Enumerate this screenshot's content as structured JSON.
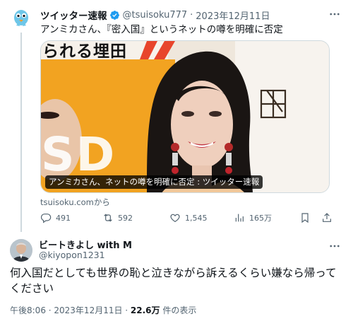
{
  "parent_tweet": {
    "display_name": "ツイッター速報",
    "handle": "@tsuisoku777",
    "separator": "·",
    "date": "2023年12月11日",
    "text": "アンミカさん、『密入国』というネットの噂を明確に否定",
    "card": {
      "banner_text": "られる埋田",
      "watermark_text": "SD",
      "caption": "アンミカさん、ネットの噂を明確に否定 : ツイッター速報"
    },
    "source": "tsuisoku.comから",
    "actions": {
      "reply_count": "491",
      "retweet_count": "592",
      "like_count": "1,545",
      "view_count": "165万"
    },
    "icons": {
      "avatar": "bird-avatar-icon",
      "verified": "verified-badge-icon",
      "more": "more-icon",
      "reply": "reply-icon",
      "retweet": "retweet-icon",
      "like": "heart-icon",
      "views": "views-icon",
      "bookmark": "bookmark-icon",
      "share": "share-icon"
    },
    "colors": {
      "verified": "#1d9bf0",
      "secondary_text": "#536471",
      "banner": "#f0c050"
    }
  },
  "main_tweet": {
    "display_name": "ビートきよし with M",
    "handle": "@kiyopon1231",
    "text": "何入国だとしても世界の恥と泣きながら訴えるくらい嫌なら帰ってください",
    "timestamp": "午後8:06 · 2023年12月11日 · ",
    "views": "22.6万",
    "views_label": " 件の表示"
  }
}
